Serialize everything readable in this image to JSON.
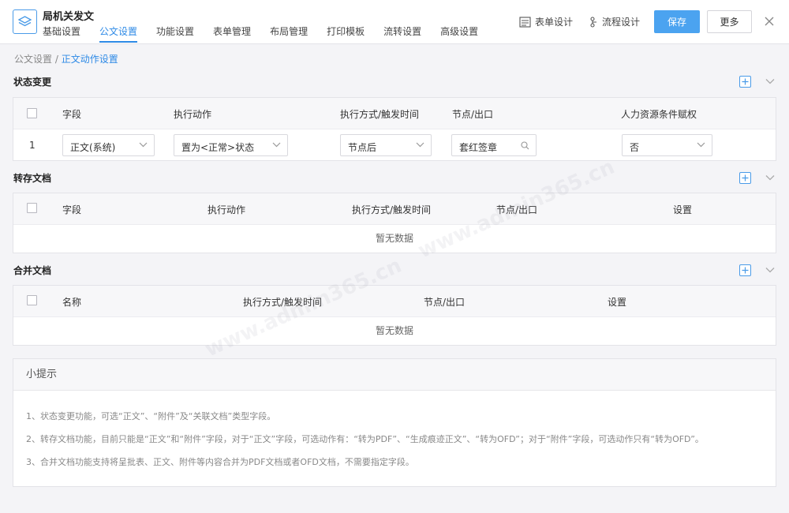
{
  "header": {
    "title": "局机关发文",
    "tabs": [
      "基础设置",
      "公文设置",
      "功能设置",
      "表单管理",
      "布局管理",
      "打印模板",
      "流转设置",
      "高级设置"
    ],
    "active_tab": "公文设置",
    "form_design": "表单设计",
    "flow_design": "流程设计",
    "save": "保存",
    "more": "更多"
  },
  "breadcrumb": {
    "parent": "公文设置",
    "sep": " / ",
    "current": "正文动作设置"
  },
  "status_change": {
    "title": "状态变更",
    "columns": [
      "字段",
      "执行动作",
      "执行方式/触发时间",
      "节点/出口",
      "人力资源条件赋权"
    ],
    "row": {
      "index": "1",
      "field": "正文(系统)",
      "action": "置为<正常>状态",
      "timing": "节点后",
      "node": "套红签章",
      "hr": "否"
    }
  },
  "save_doc": {
    "title": "转存文档",
    "columns": [
      "字段",
      "执行动作",
      "执行方式/触发时间",
      "节点/出口",
      "设置"
    ],
    "empty": "暂无数据"
  },
  "merge_doc": {
    "title": "合并文档",
    "columns": [
      "名称",
      "执行方式/触发时间",
      "节点/出口",
      "设置"
    ],
    "empty": "暂无数据"
  },
  "tips": {
    "title": "小提示",
    "lines": [
      "1、状态变更功能，可选“正文”、“附件”及“关联文档”类型字段。",
      "2、转存文档功能，目前只能是“正文”和“附件”字段，对于“正文”字段，可选动作有：“转为PDF”、“生成痕迹正文”、“转为OFD”；对于“附件”字段，可选动作只有“转为OFD”。",
      "3、合并文档功能支持将呈批表、正文、附件等内容合并为PDF文档或者OFD文档，不需要指定字段。"
    ]
  },
  "watermark": "www.admin365.cn",
  "colors": {
    "accent": "#2e8ae6",
    "save_button": "#4ba3f0"
  }
}
